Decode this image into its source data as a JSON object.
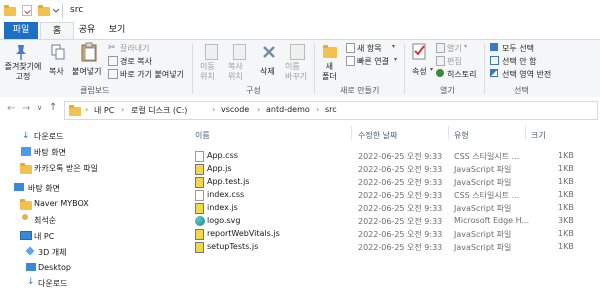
{
  "window": {
    "title": "src"
  },
  "tabs": [
    {
      "label": "파일"
    },
    {
      "label": "홈"
    },
    {
      "label": "공유"
    },
    {
      "label": "보기"
    }
  ],
  "ribbon": {
    "pin_label": "즐겨찾기에\n고정",
    "copy_label": "복사",
    "paste_label": "붙여넣기",
    "cut_label": "잘라내기",
    "copy_path_label": "경로 복사",
    "paste_shortcut_label": "바로 가기 붙여넣기",
    "clipboard_group": "클립보드",
    "move_label": "이동\n위치",
    "copyto_label": "복사\n위치",
    "delete_label": "삭제",
    "rename_label": "이름\n바꾸기",
    "organize_group": "구성",
    "newfolder_label": "새\n폴더",
    "newitem_label": "새 항목",
    "easyaccess_label": "빠른 연결",
    "new_group": "새로 만들기",
    "props_label": "속성",
    "open_label": "열기",
    "edit_label": "편집",
    "history_label": "히스토리",
    "open_group": "열기",
    "selectall_label": "모두 선택",
    "selectnone_label": "선택 안 함",
    "invert_label": "선택 영역 반전",
    "select_group": "선택"
  },
  "address": {
    "crumbs": [
      "내 PC",
      "로컬 디스크 (C:)",
      "vscode",
      "antd-demo",
      "src"
    ]
  },
  "sidebar": {
    "items": [
      {
        "label": "다운로드",
        "icon": "download-icon"
      },
      {
        "label": "바탕 화면",
        "icon": "folder-icon"
      },
      {
        "label": "카카오톡 받은 파일",
        "icon": "folder-icon"
      },
      {
        "label": "바탕 화면",
        "icon": "desktop-icon"
      },
      {
        "label": "Naver MYBOX",
        "icon": "folder-icon"
      },
      {
        "label": "최석순",
        "icon": "user-icon"
      },
      {
        "label": "내 PC",
        "icon": "pc-icon"
      },
      {
        "label": "3D 개체",
        "icon": "cube-icon"
      },
      {
        "label": "Desktop",
        "icon": "desktop-icon"
      },
      {
        "label": "다운로드",
        "icon": "download-icon"
      }
    ]
  },
  "filelist": {
    "headers": {
      "name": "이름",
      "date": "수정한 날짜",
      "type": "유형",
      "size": "크기"
    },
    "rows": [
      {
        "name": "App.css",
        "date": "2022-06-25 오전 9:33",
        "type": "CSS 스타일시트 ...",
        "size": "1KB",
        "icon": "css-file-icon"
      },
      {
        "name": "App.js",
        "date": "2022-06-25 오전 9:33",
        "type": "JavaScript 파일",
        "size": "1KB",
        "icon": "js-file-icon"
      },
      {
        "name": "App.test.js",
        "date": "2022-06-25 오전 9:33",
        "type": "JavaScript 파일",
        "size": "1KB",
        "icon": "js-file-icon"
      },
      {
        "name": "index.css",
        "date": "2022-06-25 오전 9:33",
        "type": "CSS 스타일시트 ...",
        "size": "1KB",
        "icon": "css-file-icon"
      },
      {
        "name": "index.js",
        "date": "2022-06-25 오전 9:33",
        "type": "JavaScript 파일",
        "size": "1KB",
        "icon": "js-file-icon"
      },
      {
        "name": "logo.svg",
        "date": "2022-06-25 오전 9:33",
        "type": "Microsoft Edge H...",
        "size": "3KB",
        "icon": "edge-file-icon"
      },
      {
        "name": "reportWebVitals.js",
        "date": "2022-06-25 오전 9:33",
        "type": "JavaScript 파일",
        "size": "1KB",
        "icon": "js-file-icon"
      },
      {
        "name": "setupTests.js",
        "date": "2022-06-25 오전 9:33",
        "type": "JavaScript 파일",
        "size": "1KB",
        "icon": "js-file-icon"
      }
    ]
  },
  "colors": {
    "accent": "#1f6fc4",
    "folder": "#f3c14f",
    "ribbon_bg": "#f5f6f7"
  }
}
